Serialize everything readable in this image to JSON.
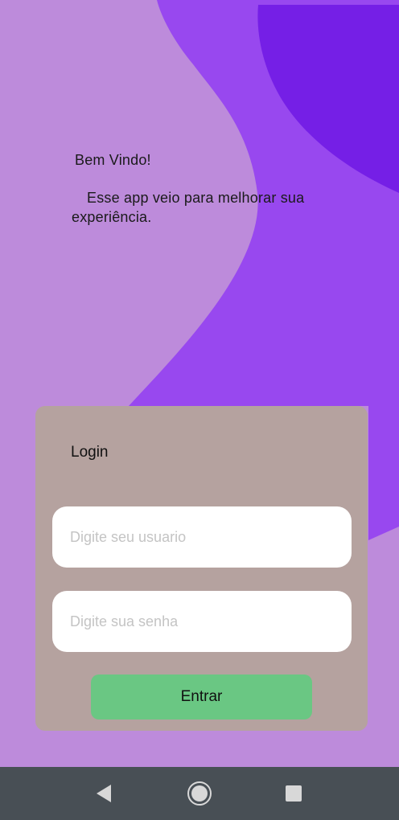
{
  "welcome": {
    "title": "Bem Vindo!",
    "subtitle": "Esse app veio para melhorar sua experiência."
  },
  "login": {
    "title": "Login",
    "username_placeholder": "Digite seu usuario",
    "password_placeholder": "Digite sua senha",
    "submit_label": "Entrar"
  },
  "navigation": {
    "buttons": [
      "back-icon",
      "home-icon",
      "recent-apps-icon"
    ]
  },
  "colors": {
    "background": "#bd8bdb",
    "wave_mid": "#9848ef",
    "wave_dark": "#751fe6",
    "card": "#b5a29f",
    "button": "#6ac783",
    "navbar": "#484f55"
  }
}
